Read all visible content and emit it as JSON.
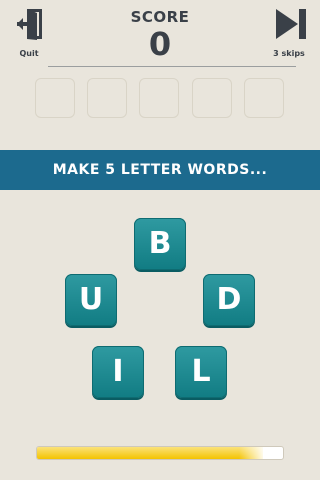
{
  "header": {
    "quit_label": "Quit",
    "score_label": "SCORE",
    "score_value": "0",
    "skips_label": "3 skips"
  },
  "answer_slots": [
    "",
    "",
    "",
    "",
    ""
  ],
  "banner": {
    "text": "MAKE 5 LETTER WORDS..."
  },
  "tiles": [
    "B",
    "U",
    "D",
    "I",
    "L"
  ],
  "timer": {
    "fraction_remaining": 0.92
  },
  "colors": {
    "background": "#e9e5dc",
    "banner": "#1c6a8e",
    "tile": "#1a8a90",
    "timer_fill": "#f4c300",
    "text_dark": "#3a4048"
  },
  "icons": {
    "quit": "exit-door-icon",
    "skip": "skip-forward-icon"
  }
}
